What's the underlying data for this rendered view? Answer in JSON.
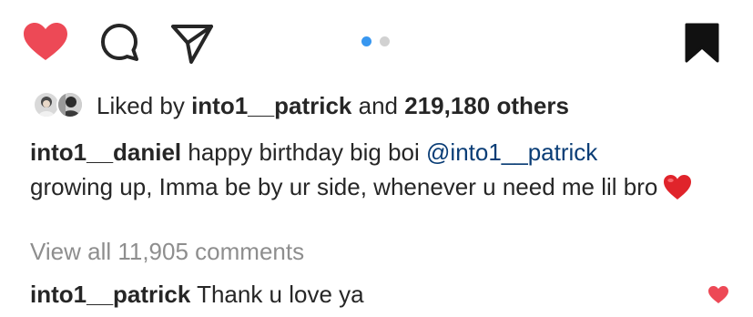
{
  "actions": {
    "like_icon": "heart-filled-icon",
    "comment_icon": "speech-bubble-icon",
    "share_icon": "paper-plane-icon",
    "save_icon": "bookmark-filled-icon",
    "like_color": "#ed4956",
    "carousel_active_color": "#3897f0",
    "carousel_inactive_color": "#d1d1d1"
  },
  "likes": {
    "prefix": "Liked by",
    "user": "into1__patrick",
    "conjunction": "and",
    "count": "219,180 others"
  },
  "caption": {
    "author": "into1__daniel",
    "text_start": "happy birthday big boi",
    "mention": "@into1__patrick",
    "text_rest": "growing up, Imma be by ur side, whenever u need me lil bro",
    "emoji": "red-heart-emoji"
  },
  "comments": {
    "view_all": "View all 11,905 comments",
    "items": [
      {
        "author": "into1__patrick",
        "text": "Thank u love ya",
        "like_icon": "heart-filled-icon"
      }
    ]
  }
}
